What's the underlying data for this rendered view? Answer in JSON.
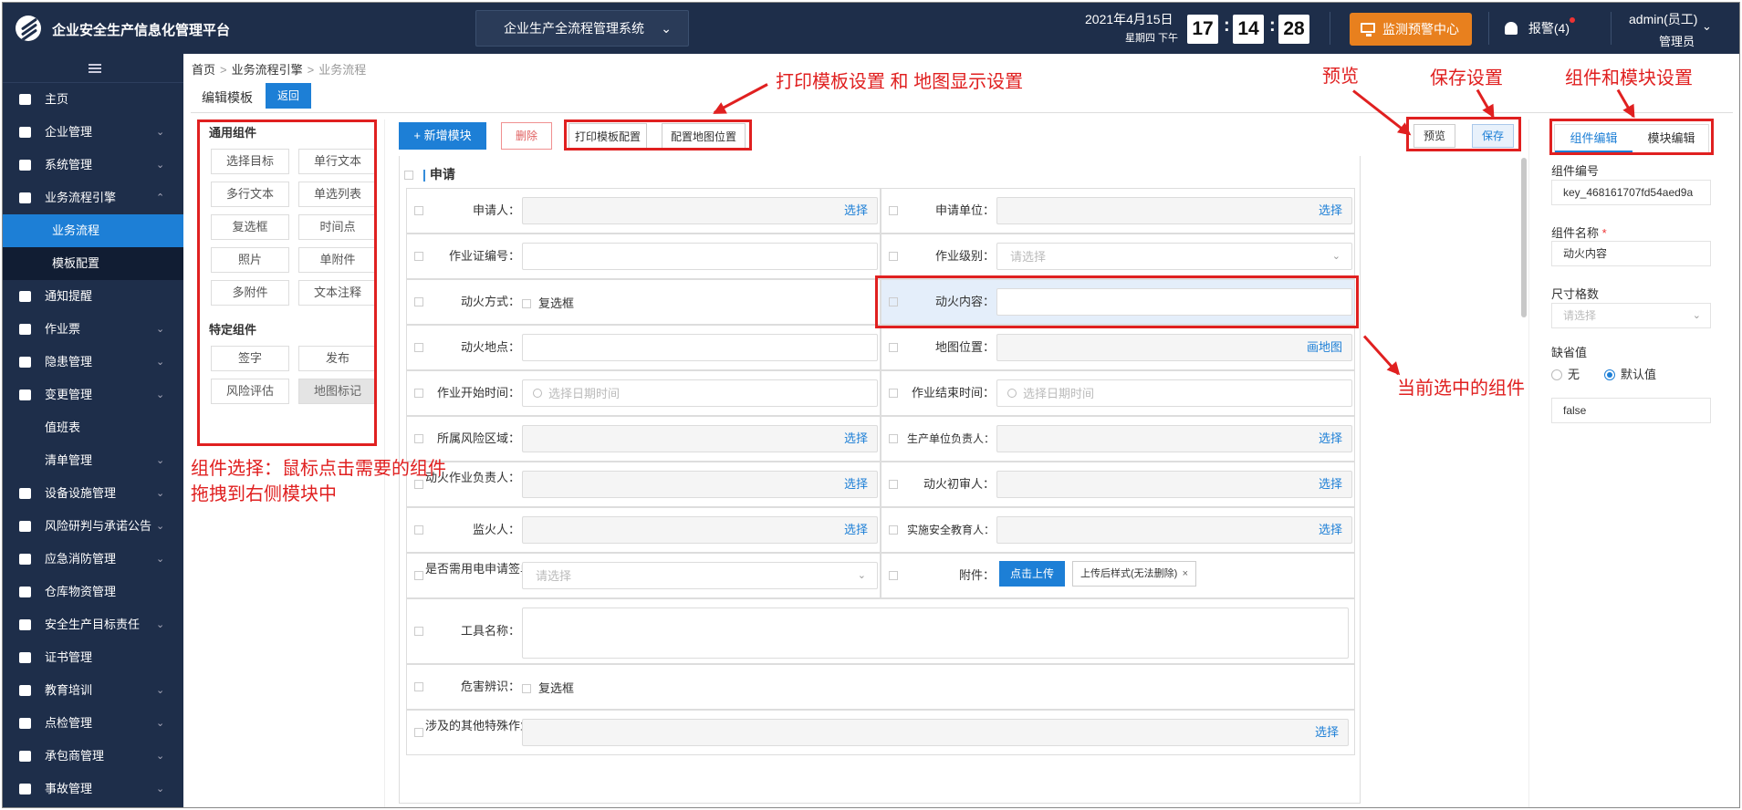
{
  "header": {
    "brand": "企业安全生产信息化管理平台",
    "system_select": "企业生产全流程管理系统",
    "date": "2021年4月15日",
    "weekday": "星期四 下午",
    "clock": {
      "h": "17",
      "m": "14",
      "s": "28"
    },
    "monitor_center": "监测预警中心",
    "alarm": "报警(4)",
    "user": "admin(员工)",
    "role": "管理员"
  },
  "sidebar": {
    "items": [
      {
        "label": "主页",
        "icon": "home-icon"
      },
      {
        "label": "企业管理",
        "icon": "building-icon"
      },
      {
        "label": "系统管理",
        "icon": "gear-icon"
      },
      {
        "label": "业务流程引擎",
        "icon": "globe-icon"
      },
      {
        "label": "业务流程",
        "icon": ""
      },
      {
        "label": "模板配置",
        "icon": ""
      },
      {
        "label": "通知提醒",
        "icon": "mail-icon"
      },
      {
        "label": "作业票",
        "icon": "ticket-icon"
      },
      {
        "label": "隐患管理",
        "icon": "bolt-icon"
      },
      {
        "label": "变更管理",
        "icon": "clipboard-icon"
      },
      {
        "label": "值班表",
        "icon": ""
      },
      {
        "label": "清单管理",
        "icon": ""
      },
      {
        "label": "设备设施管理",
        "icon": "device-icon"
      },
      {
        "label": "风险研判与承诺公告",
        "icon": "announce-icon"
      },
      {
        "label": "应急消防管理",
        "icon": "fire-icon"
      },
      {
        "label": "仓库物资管理",
        "icon": "warehouse-icon"
      },
      {
        "label": "安全生产目标责任",
        "icon": "target-icon"
      },
      {
        "label": "证书管理",
        "icon": "certificate-icon"
      },
      {
        "label": "教育培训",
        "icon": "user-icon"
      },
      {
        "label": "点检管理",
        "icon": "check-icon"
      },
      {
        "label": "承包商管理",
        "icon": "contractor-icon"
      },
      {
        "label": "事故管理",
        "icon": "warning-icon"
      }
    ]
  },
  "breadcrumb": {
    "home": "首页",
    "engine": "业务流程引擎",
    "current": "业务流程"
  },
  "page": {
    "title": "编辑模板",
    "back": "返回"
  },
  "components": {
    "general_title": "通用组件",
    "general": [
      "选择目标",
      "单行文本",
      "多行文本",
      "单选列表",
      "复选框",
      "时间点",
      "照片",
      "单附件",
      "多附件",
      "文本注释"
    ],
    "special_title": "特定组件",
    "special": [
      "签字",
      "发布",
      "风险评估",
      "地图标记"
    ]
  },
  "toolbar": {
    "add_module": "+ 新增模块",
    "delete": "删除",
    "print_config": "打印模板配置",
    "map_config": "配置地图位置",
    "preview": "预览",
    "save": "保存"
  },
  "form": {
    "section_title": "申请",
    "select_text": "选择",
    "draw_map": "画地图",
    "placeholder_select": "请选择",
    "placeholder_datetime": "选择日期时间",
    "checkbox_label": "复选框",
    "upload_btn": "点击上传",
    "upload_tag": "上传后样式(无法删除)",
    "labels": {
      "applicant": "申请人：",
      "applicant_unit": "申请单位：",
      "work_cert_no": "作业证编号：",
      "work_level": "作业级别：",
      "fire_method": "动火方式：",
      "fire_content": "动火内容：",
      "fire_location": "动火地点：",
      "map_position": "地图位置：",
      "start_time": "作业开始时间：",
      "end_time": "作业结束时间：",
      "risk_area": "所属风险区域：",
      "prod_unit_head": "生产单位负责人：",
      "fire_work_head": "动火作业负责人：",
      "fire_first_review": "动火初审人：",
      "fire_monitor": "监火人：",
      "safety_educator": "实施安全教育人：",
      "need_power_ticket": "是否需用电申请签单：",
      "attachment": "附件：",
      "tool_name": "工具名称：",
      "hazard_identify": "危害辨识：",
      "other_special_work": "涉及的其他特殊作业："
    }
  },
  "right_panel": {
    "tab_component": "组件编辑",
    "tab_module": "模块编辑",
    "code_label": "组件编号",
    "code_value": "key_468161707fd54aed9a",
    "name_label": "组件名称",
    "name_value": "动火内容",
    "size_label": "尺寸格数",
    "size_placeholder": "请选择",
    "default_label": "缺省值",
    "radio_none": "无",
    "radio_default": "默认值",
    "default_value": "false"
  },
  "annotations": {
    "print_map": "打印模板设置 和 地图显示设置",
    "preview": "预览",
    "save": "保存设置",
    "comp_module": "组件和模块设置",
    "current_selected": "当前选中的组件",
    "component_select_1": "组件选择：鼠标点击需要的组件",
    "component_select_2": "拖拽到右侧模块中"
  },
  "colors": {
    "primary": "#1d7fd6",
    "header_bg": "#1e2e4a",
    "monitor_btn": "#e8801e",
    "annotation_red": "#e02020"
  }
}
